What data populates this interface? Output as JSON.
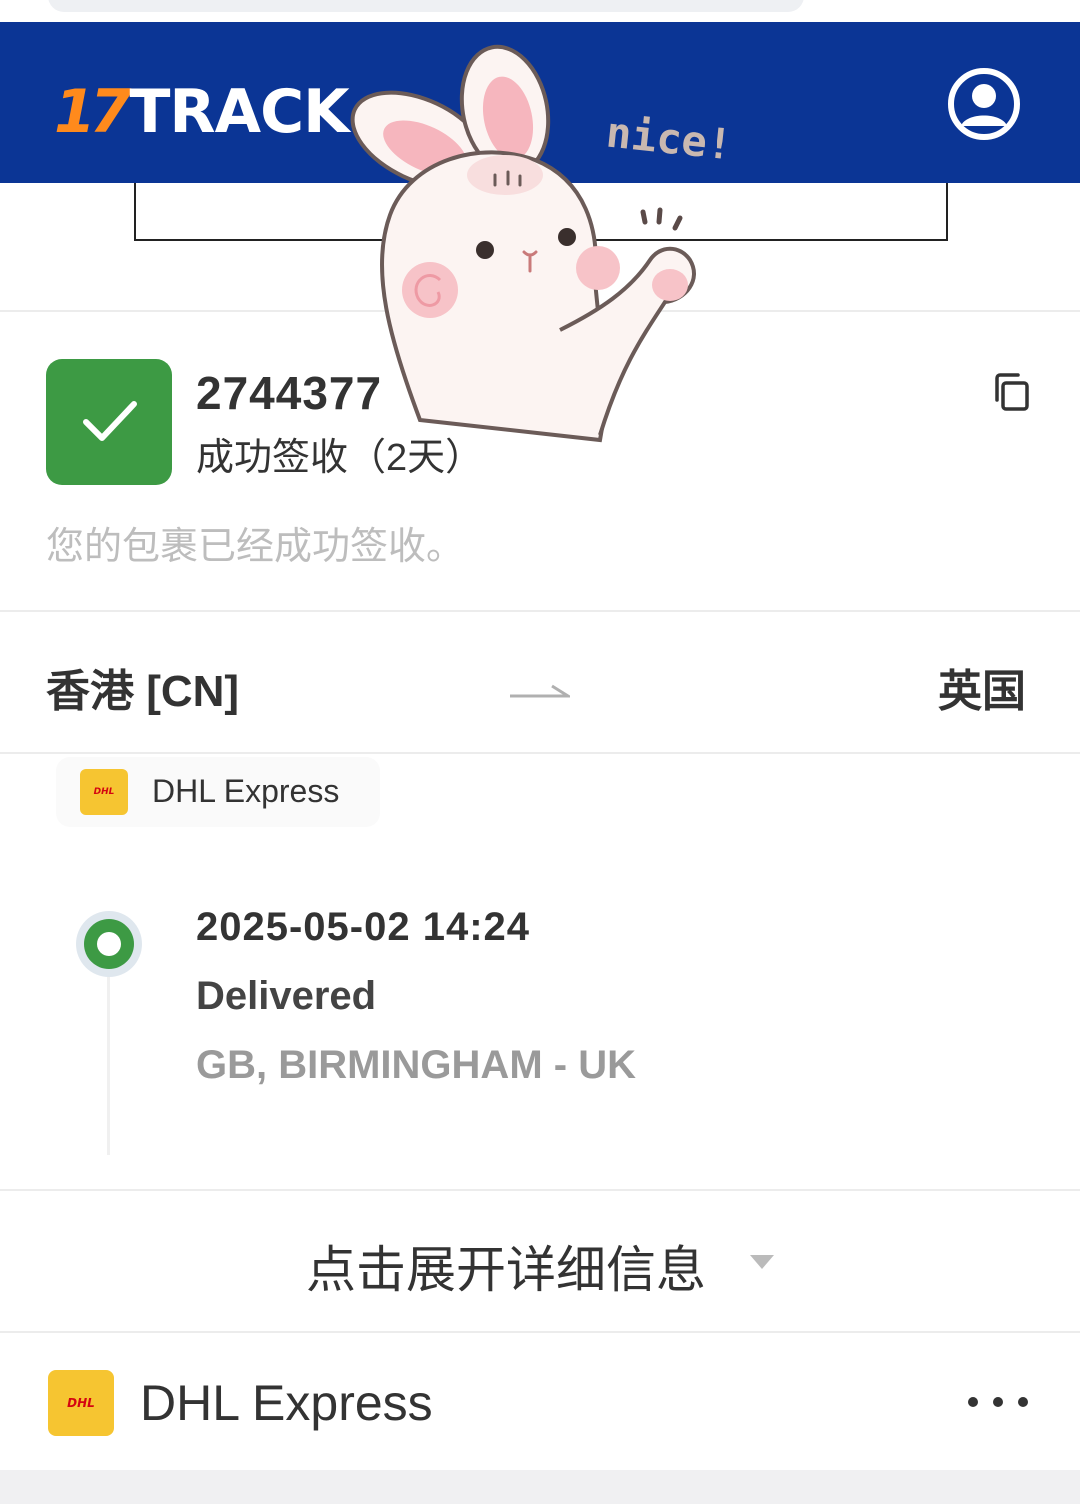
{
  "header": {
    "logo_number": "17",
    "logo_text": "TRACK",
    "colors": {
      "brand_blue": "#0b3595",
      "logo_orange": "#ff8a1c"
    },
    "account_icon": "user-circle-icon"
  },
  "shipment": {
    "tracking_number": "2744377",
    "status": "成功签收（2天）",
    "description": "您的包裹已经成功签收。",
    "status_color": "#3d9a44",
    "status_icon": "check-icon",
    "copy_icon": "copy-icon"
  },
  "route": {
    "origin": "香港 [CN]",
    "destination": "英国",
    "arrow_icon": "arrow-right-icon"
  },
  "carrier_chip": {
    "logo_text": "DHL",
    "label": "DHL Express"
  },
  "timeline": {
    "events": [
      {
        "time": "2025-05-02 14:24",
        "status": "Delivered",
        "location": "GB, BIRMINGHAM - UK"
      }
    ]
  },
  "expand": {
    "label": "点击展开详细信息",
    "caret_icon": "caret-down-icon"
  },
  "carrier_row": {
    "logo_text": "DHL",
    "label": "DHL Express",
    "more_icon": "more-horizontal-icon"
  },
  "sticker": {
    "text": "nice!",
    "icon": "bunny-thumbs-up-sticker"
  }
}
